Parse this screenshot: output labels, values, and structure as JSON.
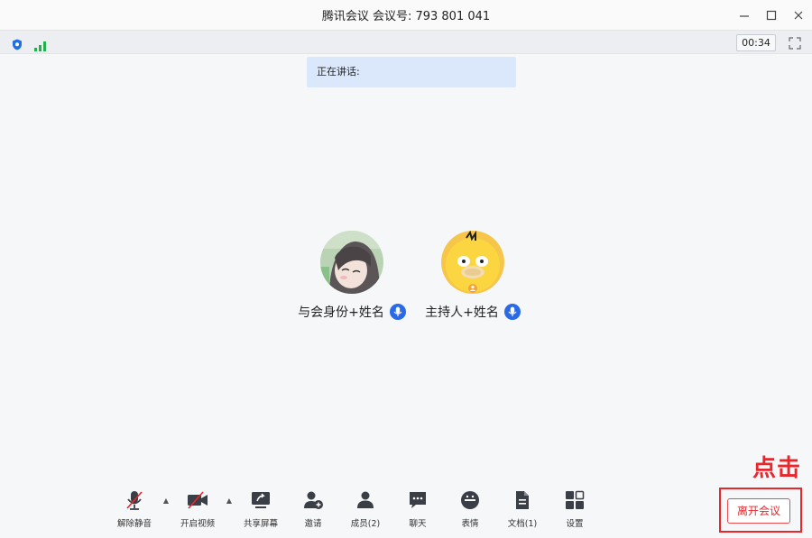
{
  "window": {
    "title": "腾讯会议 会议号: 793 801 041",
    "controls": [
      "minimize-icon",
      "maximize-icon",
      "close-icon"
    ]
  },
  "status": {
    "timer": "00:34",
    "shield_color": "#1e6fe6",
    "signal_color": "#22b14c"
  },
  "speaking_banner": "正在讲话:",
  "participants": [
    {
      "name": "与会身份+姓名",
      "avatar": "anime-girl-avatar",
      "mic": "mic-on-icon"
    },
    {
      "name": "主持人+姓名",
      "avatar": "yellow-duck-avatar",
      "mic": "mic-on-icon"
    }
  ],
  "toolbar": {
    "items": [
      {
        "label": "解除静音",
        "icon": "mic-muted-icon"
      },
      {
        "label": "开启视频",
        "icon": "video-off-icon"
      },
      {
        "label": "共享屏幕",
        "icon": "share-screen-icon"
      },
      {
        "label": "邀请",
        "icon": "invite-icon"
      },
      {
        "label": "成员(2)",
        "icon": "members-icon"
      },
      {
        "label": "聊天",
        "icon": "chat-icon"
      },
      {
        "label": "表情",
        "icon": "emoji-icon"
      },
      {
        "label": "文档(1)",
        "icon": "document-icon"
      },
      {
        "label": "设置",
        "icon": "settings-icon"
      }
    ]
  },
  "annotation": "点击",
  "leave_button": "离开会议",
  "colors": {
    "accent_blue": "#2a6ae6",
    "leave_red": "#e8262b"
  }
}
